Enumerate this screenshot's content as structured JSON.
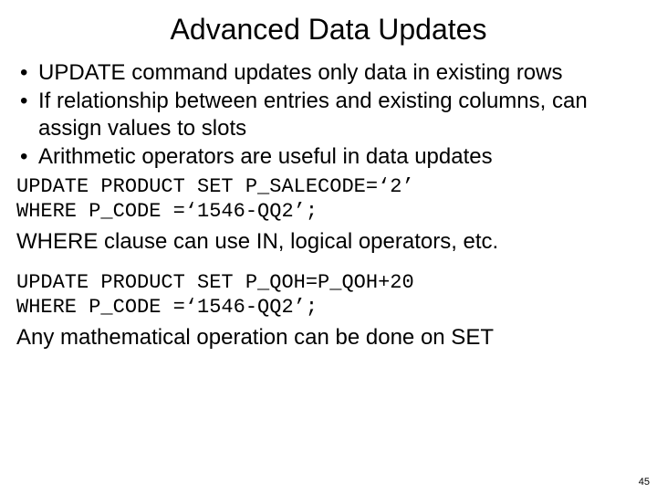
{
  "title": "Advanced Data Updates",
  "bullets": [
    "UPDATE command updates only data in existing rows",
    "If relationship between entries and existing columns, can assign values to slots",
    "Arithmetic operators are useful in data updates"
  ],
  "code1": "UPDATE PRODUCT SET P_SALECODE=‘2’\nWHERE P_CODE =‘1546-QQ2’;",
  "body1": "WHERE  clause can use IN, logical operators, etc.",
  "code2": "UPDATE PRODUCT SET P_QOH=P_QOH+20\nWHERE P_CODE =‘1546-QQ2’;",
  "body2": "Any mathematical operation can be done on SET",
  "page_number": "45"
}
